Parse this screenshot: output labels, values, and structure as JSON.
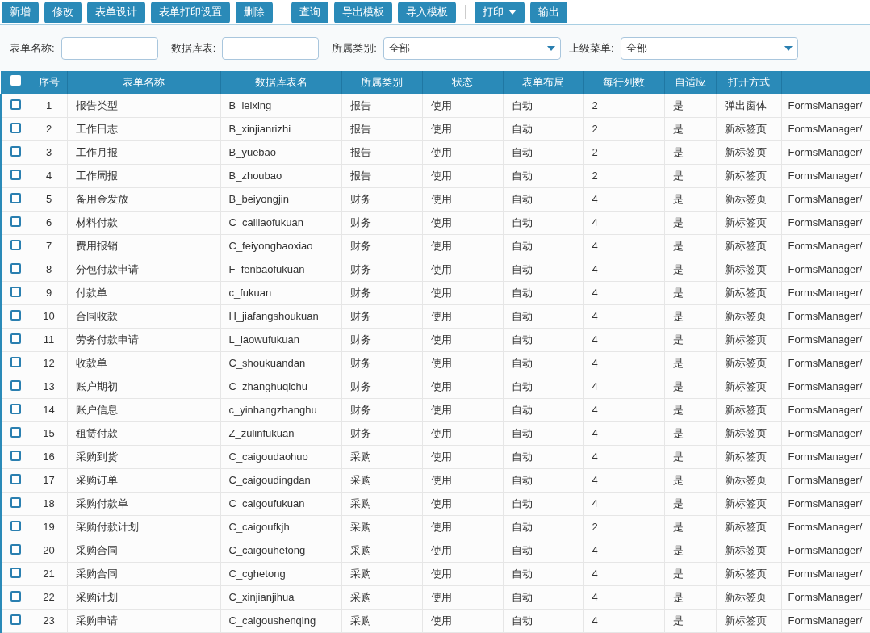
{
  "toolbar": [
    {
      "label": "新增",
      "kind": "button"
    },
    {
      "label": "修改",
      "kind": "button"
    },
    {
      "label": "表单设计",
      "kind": "button"
    },
    {
      "label": "表单打印设置",
      "kind": "button"
    },
    {
      "label": "删除",
      "kind": "button"
    },
    {
      "kind": "separator"
    },
    {
      "label": "查询",
      "kind": "button"
    },
    {
      "label": "导出模板",
      "kind": "button"
    },
    {
      "label": "导入模板",
      "kind": "button"
    },
    {
      "kind": "separator"
    },
    {
      "label": "打印",
      "kind": "dropdown"
    },
    {
      "label": "输出",
      "kind": "button"
    }
  ],
  "filters": [
    {
      "label": "表单名称:",
      "kind": "text"
    },
    {
      "label": "数据库表:",
      "kind": "text"
    },
    {
      "label": "所属类别:",
      "kind": "select",
      "value": "全部"
    },
    {
      "label": "上级菜单:",
      "kind": "select",
      "value": "全部"
    }
  ],
  "table": {
    "select_all_checked": false,
    "columns": [
      "序号",
      "表单名称",
      "数据库表名",
      "所属类别",
      "状态",
      "表单布局",
      "每行列数",
      "自适应",
      "打开方式"
    ],
    "rows": [
      {
        "checked": false,
        "cells": [
          "1",
          "报告类型",
          "B_leixing",
          "报告",
          "使用",
          "自动",
          "2",
          "是",
          "弹出窗体",
          "FormsManager/"
        ]
      },
      {
        "checked": false,
        "cells": [
          "2",
          "工作日志",
          "B_xinjianrizhi",
          "报告",
          "使用",
          "自动",
          "2",
          "是",
          "新标签页",
          "FormsManager/"
        ]
      },
      {
        "checked": false,
        "cells": [
          "3",
          "工作月报",
          "B_yuebao",
          "报告",
          "使用",
          "自动",
          "2",
          "是",
          "新标签页",
          "FormsManager/"
        ]
      },
      {
        "checked": false,
        "cells": [
          "4",
          "工作周报",
          "B_zhoubao",
          "报告",
          "使用",
          "自动",
          "2",
          "是",
          "新标签页",
          "FormsManager/"
        ]
      },
      {
        "checked": false,
        "cells": [
          "5",
          "备用金发放",
          "B_beiyongjin",
          "财务",
          "使用",
          "自动",
          "4",
          "是",
          "新标签页",
          "FormsManager/"
        ]
      },
      {
        "checked": false,
        "cells": [
          "6",
          "材料付款",
          "C_cailiaofukuan",
          "财务",
          "使用",
          "自动",
          "4",
          "是",
          "新标签页",
          "FormsManager/"
        ]
      },
      {
        "checked": false,
        "cells": [
          "7",
          "费用报销",
          "C_feiyongbaoxiao",
          "财务",
          "使用",
          "自动",
          "4",
          "是",
          "新标签页",
          "FormsManager/"
        ]
      },
      {
        "checked": false,
        "cells": [
          "8",
          "分包付款申请",
          "F_fenbaofukuan",
          "财务",
          "使用",
          "自动",
          "4",
          "是",
          "新标签页",
          "FormsManager/"
        ]
      },
      {
        "checked": false,
        "cells": [
          "9",
          "付款单",
          "c_fukuan",
          "财务",
          "使用",
          "自动",
          "4",
          "是",
          "新标签页",
          "FormsManager/"
        ]
      },
      {
        "checked": false,
        "cells": [
          "10",
          "合同收款",
          "H_jiafangshoukuan",
          "财务",
          "使用",
          "自动",
          "4",
          "是",
          "新标签页",
          "FormsManager/"
        ]
      },
      {
        "checked": false,
        "cells": [
          "11",
          "劳务付款申请",
          "L_laowufukuan",
          "财务",
          "使用",
          "自动",
          "4",
          "是",
          "新标签页",
          "FormsManager/"
        ]
      },
      {
        "checked": false,
        "cells": [
          "12",
          "收款单",
          "C_shoukuandan",
          "财务",
          "使用",
          "自动",
          "4",
          "是",
          "新标签页",
          "FormsManager/"
        ]
      },
      {
        "checked": false,
        "cells": [
          "13",
          "账户期初",
          "C_zhanghuqichu",
          "财务",
          "使用",
          "自动",
          "4",
          "是",
          "新标签页",
          "FormsManager/"
        ]
      },
      {
        "checked": false,
        "cells": [
          "14",
          "账户信息",
          "c_yinhangzhanghu",
          "财务",
          "使用",
          "自动",
          "4",
          "是",
          "新标签页",
          "FormsManager/"
        ]
      },
      {
        "checked": false,
        "cells": [
          "15",
          "租赁付款",
          "Z_zulinfukuan",
          "财务",
          "使用",
          "自动",
          "4",
          "是",
          "新标签页",
          "FormsManager/"
        ]
      },
      {
        "checked": false,
        "cells": [
          "16",
          "采购到货",
          "C_caigoudaohuo",
          "采购",
          "使用",
          "自动",
          "4",
          "是",
          "新标签页",
          "FormsManager/"
        ]
      },
      {
        "checked": false,
        "cells": [
          "17",
          "采购订单",
          "C_caigoudingdan",
          "采购",
          "使用",
          "自动",
          "4",
          "是",
          "新标签页",
          "FormsManager/"
        ]
      },
      {
        "checked": false,
        "cells": [
          "18",
          "采购付款单",
          "C_caigoufukuan",
          "采购",
          "使用",
          "自动",
          "4",
          "是",
          "新标签页",
          "FormsManager/"
        ]
      },
      {
        "checked": false,
        "cells": [
          "19",
          "采购付款计划",
          "C_caigoufkjh",
          "采购",
          "使用",
          "自动",
          "2",
          "是",
          "新标签页",
          "FormsManager/"
        ]
      },
      {
        "checked": false,
        "cells": [
          "20",
          "采购合同",
          "C_caigouhetong",
          "采购",
          "使用",
          "自动",
          "4",
          "是",
          "新标签页",
          "FormsManager/"
        ]
      },
      {
        "checked": false,
        "cells": [
          "21",
          "采购合同",
          "C_cghetong",
          "采购",
          "使用",
          "自动",
          "4",
          "是",
          "新标签页",
          "FormsManager/"
        ]
      },
      {
        "checked": false,
        "cells": [
          "22",
          "采购计划",
          "C_xinjianjihua",
          "采购",
          "使用",
          "自动",
          "4",
          "是",
          "新标签页",
          "FormsManager/"
        ]
      },
      {
        "checked": false,
        "cells": [
          "23",
          "采购申请",
          "C_caigoushenqing",
          "采购",
          "使用",
          "自动",
          "4",
          "是",
          "新标签页",
          "FormsManager/"
        ]
      }
    ]
  }
}
